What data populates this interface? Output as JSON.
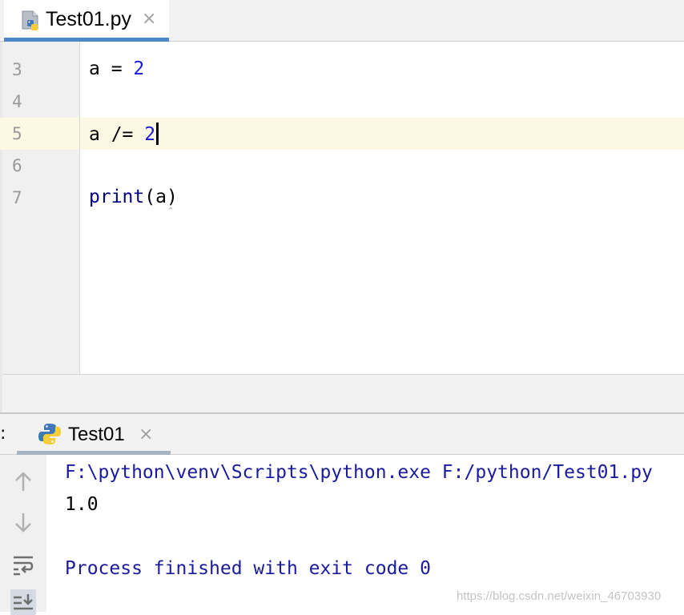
{
  "editor_tab": {
    "label": "Test01.py",
    "close": "×"
  },
  "editor": {
    "lines": [
      {
        "number": "3",
        "code_parts": [
          "a = ",
          "2"
        ]
      },
      {
        "number": "4"
      },
      {
        "number": "5",
        "code_parts": [
          "a /= ",
          "2"
        ],
        "current": true
      },
      {
        "number": "6"
      },
      {
        "number": "7",
        "code_parts": [
          "print",
          "(a)"
        ]
      }
    ]
  },
  "run_panel": {
    "prefix": ":",
    "tab_label": "Test01",
    "close": "×",
    "toolbar": [
      "up-arrow-icon",
      "down-arrow-icon",
      "soft-wrap-icon",
      "scroll-to-end-icon"
    ],
    "console": {
      "command": "F:\\python\\venv\\Scripts\\python.exe F:/python/Test01.py",
      "output": "1.0",
      "exit": "Process finished with exit code 0"
    }
  },
  "watermark": "https://blog.csdn.net/weixin_46703930",
  "colors": {
    "accent_tab": "#4a88c7",
    "number": "#1a1ad4",
    "console_blue": "#1a1a9e",
    "current_line": "#fdf8e4"
  }
}
